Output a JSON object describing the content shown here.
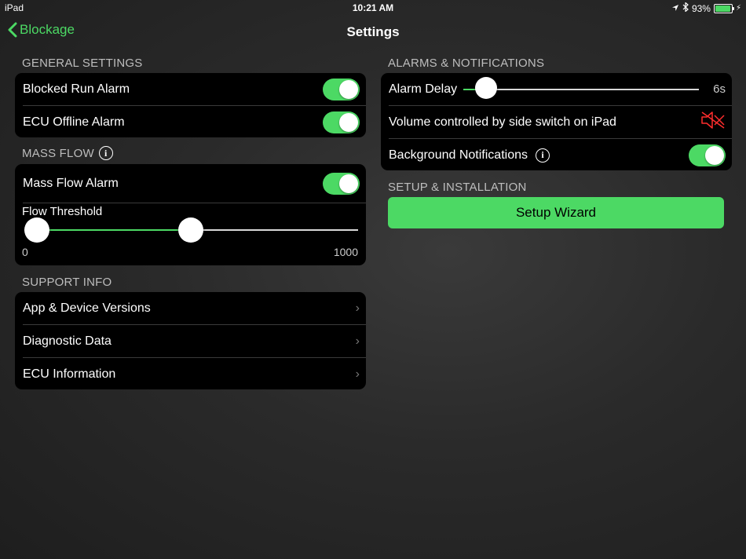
{
  "status_bar": {
    "device": "iPad",
    "time": "10:21 AM",
    "battery": "93%",
    "battery_level": 0.93
  },
  "nav": {
    "back_label": "Blockage",
    "title": "Settings"
  },
  "general": {
    "header": "GENERAL SETTINGS",
    "rows": [
      {
        "label": "Blocked Run Alarm",
        "on": true
      },
      {
        "label": "ECU Offline Alarm",
        "on": true
      }
    ]
  },
  "mass_flow": {
    "header": "MASS FLOW",
    "alarm_label": "Mass Flow Alarm",
    "alarm_on": true,
    "threshold_label": "Flow Threshold",
    "min": "0",
    "max": "1000",
    "low_value": 0,
    "high_value": 460
  },
  "support": {
    "header": "SUPPORT INFO",
    "rows": [
      {
        "label": "App & Device Versions"
      },
      {
        "label": "Diagnostic Data"
      },
      {
        "label": "ECU Information"
      }
    ]
  },
  "alarms": {
    "header": "ALARMS & NOTIFICATIONS",
    "delay_label": "Alarm Delay",
    "delay_value": "6s",
    "delay_fraction": 0.05,
    "volume_label": "Volume controlled by side switch on iPad",
    "volume_icon": "speaker-muted-icon",
    "volume_icon_color": "#ff2d2d",
    "bg_notifications_label": "Background Notifications",
    "bg_notifications_on": true
  },
  "setup": {
    "header": "SETUP & INSTALLATION",
    "wizard_label": "Setup Wizard"
  },
  "colors": {
    "accent": "#4cd964",
    "card": "#000000",
    "muted_red": "#ff2d2d"
  }
}
